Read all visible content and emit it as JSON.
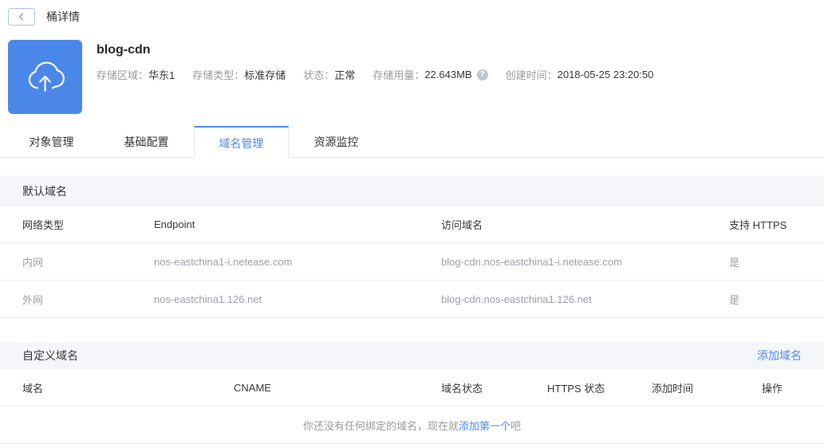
{
  "colors": {
    "accent_blue": "#4a87e8",
    "section_bar_bg": "#f5f6fa",
    "help_icon_bg": "#c0c4cc",
    "muted_text": "#9b9ea3",
    "border": "#ebedf0"
  },
  "topbar": {
    "back_icon": "chevron-left",
    "title": "桶详情"
  },
  "bucket": {
    "icon": "cloud-upload-icon",
    "name": "blog-cdn",
    "info": [
      {
        "label": "存储区域：",
        "value": "华东1"
      },
      {
        "label": "存储类型：",
        "value": "标准存储"
      },
      {
        "label": "状态：",
        "value": "正常"
      },
      {
        "label": "存储用量：",
        "value": "22.643MB",
        "help_icon": "?"
      },
      {
        "label": "创建时间：",
        "value": "2018-05-25 23:20:50"
      }
    ]
  },
  "tabs": [
    {
      "label": "对象管理",
      "active": false
    },
    {
      "label": "基础配置",
      "active": false
    },
    {
      "label": "域名管理",
      "active": true
    },
    {
      "label": "资源监控",
      "active": false
    }
  ],
  "default_domain": {
    "section_title": "默认域名",
    "headers": [
      "网络类型",
      "Endpoint",
      "访问域名",
      "支持 HTTPS"
    ],
    "rows": [
      [
        "内网",
        "nos-eastchina1-i.netease.com",
        "blog-cdn.nos-eastchina1-i.netease.com",
        "是"
      ],
      [
        "外网",
        "nos-eastchina1.126.net",
        "blog-cdn.nos-eastchina1.126.net",
        "是"
      ]
    ]
  },
  "custom_domain": {
    "section_title": "自定义域名",
    "add_link_label": "添加域名",
    "headers": [
      "域名",
      "CNAME",
      "域名状态",
      "HTTPS 状态",
      "添加时间",
      "操作"
    ],
    "empty_state": {
      "text_before": "你还没有任何绑定的域名，现在就",
      "link": "添加第一个",
      "text_after": "吧"
    }
  }
}
